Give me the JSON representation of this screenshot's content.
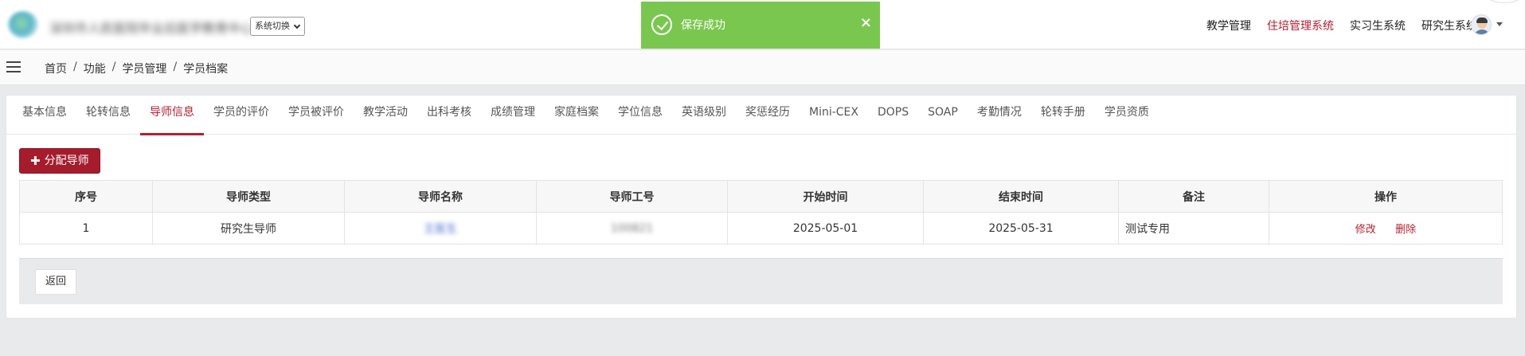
{
  "header": {
    "org_name": "深圳市人民医院毕业后医学教育中心",
    "system_switch": "系统切换",
    "nav": [
      {
        "label": "教学管理",
        "active": false
      },
      {
        "label": "住培管理系统",
        "active": true
      },
      {
        "label": "实习生系统",
        "active": false
      },
      {
        "label": "研究生系统",
        "active": false
      }
    ]
  },
  "toast": {
    "message": "保存成功",
    "close": "×"
  },
  "breadcrumb": {
    "items": [
      "首页",
      "功能",
      "学员管理",
      "学员档案"
    ],
    "separator": "/"
  },
  "tabs": [
    {
      "label": "基本信息",
      "active": false
    },
    {
      "label": "轮转信息",
      "active": false
    },
    {
      "label": "导师信息",
      "active": true
    },
    {
      "label": "学员的评价",
      "active": false
    },
    {
      "label": "学员被评价",
      "active": false
    },
    {
      "label": "教学活动",
      "active": false
    },
    {
      "label": "出科考核",
      "active": false
    },
    {
      "label": "成绩管理",
      "active": false
    },
    {
      "label": "家庭档案",
      "active": false
    },
    {
      "label": "学位信息",
      "active": false
    },
    {
      "label": "英语级别",
      "active": false
    },
    {
      "label": "奖惩经历",
      "active": false
    },
    {
      "label": "Mini-CEX",
      "active": false
    },
    {
      "label": "DOPS",
      "active": false
    },
    {
      "label": "SOAP",
      "active": false
    },
    {
      "label": "考勤情况",
      "active": false
    },
    {
      "label": "轮转手册",
      "active": false
    },
    {
      "label": "学员资质",
      "active": false
    }
  ],
  "actions": {
    "assign_tutor": "分配导师",
    "back": "返回"
  },
  "table": {
    "columns": [
      "序号",
      "导师类型",
      "导师名称",
      "导师工号",
      "开始时间",
      "结束时间",
      "备注",
      "操作"
    ],
    "rows": [
      {
        "index": "1",
        "type": "研究生导师",
        "name": "王医生",
        "code": "100821",
        "start": "2025-05-01",
        "end": "2025-05-31",
        "note": "测试专用",
        "op_edit": "修改",
        "op_delete": "删除"
      }
    ]
  },
  "colors": {
    "brand": "#b32030",
    "toast": "#7ac74f"
  }
}
